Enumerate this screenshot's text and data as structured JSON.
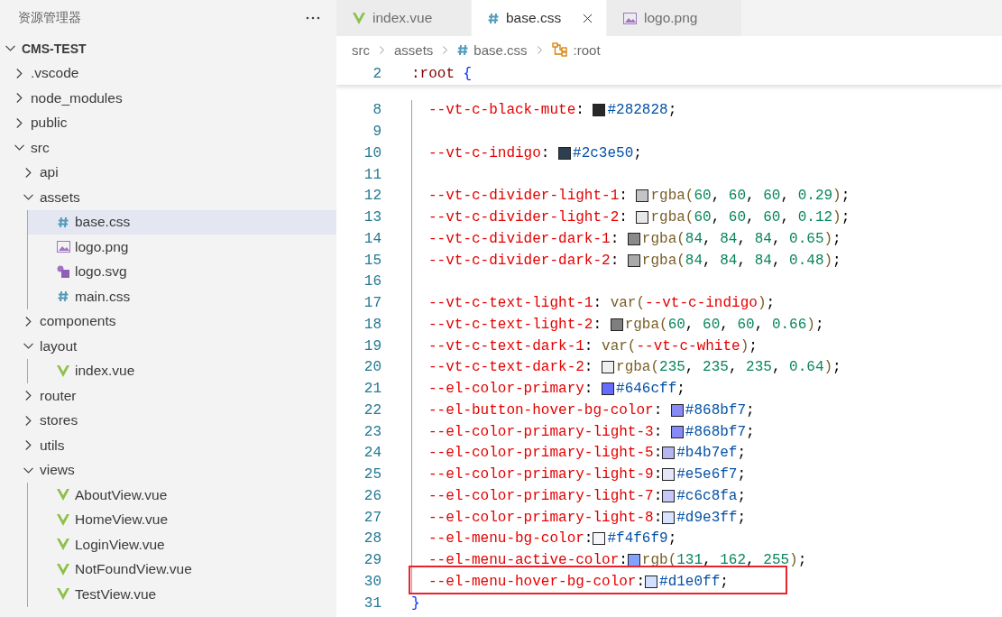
{
  "sidebar": {
    "title": "资源管理器",
    "root": {
      "label": "CMS-TEST",
      "kind": "folder",
      "expanded": true,
      "selected": false,
      "children": [
        {
          "label": ".vscode",
          "kind": "folder",
          "expanded": false,
          "selected": false
        },
        {
          "label": "node_modules",
          "kind": "folder",
          "expanded": false,
          "selected": false
        },
        {
          "label": "public",
          "kind": "folder",
          "expanded": false,
          "selected": false
        },
        {
          "label": "src",
          "kind": "folder",
          "expanded": true,
          "selected": false,
          "children": [
            {
              "label": "api",
              "kind": "folder",
              "expanded": false,
              "selected": false
            },
            {
              "label": "assets",
              "kind": "folder",
              "expanded": true,
              "selected": false,
              "children": [
                {
                  "label": "base.css",
                  "kind": "css",
                  "selected": true
                },
                {
                  "label": "logo.png",
                  "kind": "image",
                  "selected": false
                },
                {
                  "label": "logo.svg",
                  "kind": "svg",
                  "selected": false
                },
                {
                  "label": "main.css",
                  "kind": "css",
                  "selected": false
                }
              ]
            },
            {
              "label": "components",
              "kind": "folder",
              "expanded": false,
              "selected": false
            },
            {
              "label": "layout",
              "kind": "folder",
              "expanded": true,
              "selected": false,
              "children": [
                {
                  "label": "index.vue",
                  "kind": "vue",
                  "selected": false
                }
              ]
            },
            {
              "label": "router",
              "kind": "folder",
              "expanded": false,
              "selected": false
            },
            {
              "label": "stores",
              "kind": "folder",
              "expanded": false,
              "selected": false
            },
            {
              "label": "utils",
              "kind": "folder",
              "expanded": false,
              "selected": false
            },
            {
              "label": "views",
              "kind": "folder",
              "expanded": true,
              "selected": false,
              "children": [
                {
                  "label": "AboutView.vue",
                  "kind": "vue",
                  "selected": false
                },
                {
                  "label": "HomeView.vue",
                  "kind": "vue",
                  "selected": false
                },
                {
                  "label": "LoginView.vue",
                  "kind": "vue",
                  "selected": false
                },
                {
                  "label": "NotFoundView.vue",
                  "kind": "vue",
                  "selected": false
                },
                {
                  "label": "TestView.vue",
                  "kind": "vue",
                  "selected": false
                }
              ]
            }
          ]
        }
      ]
    }
  },
  "tabs": [
    {
      "label": "index.vue",
      "kind": "vue",
      "selected": false
    },
    {
      "label": "base.css",
      "kind": "css",
      "selected": true
    },
    {
      "label": "logo.png",
      "kind": "image",
      "selected": false
    }
  ],
  "breadcrumb": [
    {
      "label": "src",
      "kind": "folder"
    },
    {
      "label": "assets",
      "kind": "folder"
    },
    {
      "label": "base.css",
      "kind": "css"
    },
    {
      "label": ":root",
      "kind": "symbol"
    }
  ],
  "sticky_line": {
    "number": "2",
    "tokens": [
      {
        "kind": "selector",
        "text": ":root"
      },
      {
        "kind": "brace",
        "text": " {"
      }
    ]
  },
  "lines": [
    {
      "number": "8",
      "kind": "decl",
      "tokens": [
        {
          "kind": "prop",
          "text": "--vt-c-black-mute"
        },
        {
          "kind": "punct",
          "text": ": "
        },
        {
          "kind": "swatch",
          "color": "#282828"
        },
        {
          "kind": "hex",
          "text": "#282828"
        },
        {
          "kind": "punct",
          "text": ";"
        }
      ]
    },
    {
      "number": "9",
      "kind": "decl"
    },
    {
      "number": "10",
      "kind": "decl",
      "tokens": [
        {
          "kind": "prop",
          "text": "--vt-c-indigo"
        },
        {
          "kind": "punct",
          "text": ": "
        },
        {
          "kind": "swatch",
          "color": "#2c3e50"
        },
        {
          "kind": "hex",
          "text": "#2c3e50"
        },
        {
          "kind": "punct",
          "text": ";"
        }
      ]
    },
    {
      "number": "11",
      "kind": "decl"
    },
    {
      "number": "12",
      "kind": "decl",
      "tokens": [
        {
          "kind": "prop",
          "text": "--vt-c-divider-light-1"
        },
        {
          "kind": "punct",
          "text": ": "
        },
        {
          "kind": "swatch",
          "color": "#c4c4c4"
        },
        {
          "kind": "fn",
          "text": "rgba("
        },
        {
          "kind": "num",
          "text": "60"
        },
        {
          "kind": "punct",
          "text": ", "
        },
        {
          "kind": "num",
          "text": "60"
        },
        {
          "kind": "punct",
          "text": ", "
        },
        {
          "kind": "num",
          "text": "60"
        },
        {
          "kind": "punct",
          "text": ", "
        },
        {
          "kind": "num",
          "text": "0.29"
        },
        {
          "kind": "fn",
          "text": ")"
        },
        {
          "kind": "punct",
          "text": ";"
        }
      ]
    },
    {
      "number": "13",
      "kind": "decl",
      "tokens": [
        {
          "kind": "prop",
          "text": "--vt-c-divider-light-2"
        },
        {
          "kind": "punct",
          "text": ": "
        },
        {
          "kind": "swatch",
          "color": "#e7e7e7"
        },
        {
          "kind": "fn",
          "text": "rgba("
        },
        {
          "kind": "num",
          "text": "60"
        },
        {
          "kind": "punct",
          "text": ", "
        },
        {
          "kind": "num",
          "text": "60"
        },
        {
          "kind": "punct",
          "text": ", "
        },
        {
          "kind": "num",
          "text": "60"
        },
        {
          "kind": "punct",
          "text": ", "
        },
        {
          "kind": "num",
          "text": "0.12"
        },
        {
          "kind": "fn",
          "text": ")"
        },
        {
          "kind": "punct",
          "text": ";"
        }
      ]
    },
    {
      "number": "14",
      "kind": "decl",
      "tokens": [
        {
          "kind": "prop",
          "text": "--vt-c-divider-dark-1"
        },
        {
          "kind": "punct",
          "text": ": "
        },
        {
          "kind": "swatch",
          "color": "#8a8a8a"
        },
        {
          "kind": "fn",
          "text": "rgba("
        },
        {
          "kind": "num",
          "text": "84"
        },
        {
          "kind": "punct",
          "text": ", "
        },
        {
          "kind": "num",
          "text": "84"
        },
        {
          "kind": "punct",
          "text": ", "
        },
        {
          "kind": "num",
          "text": "84"
        },
        {
          "kind": "punct",
          "text": ", "
        },
        {
          "kind": "num",
          "text": "0.65"
        },
        {
          "kind": "fn",
          "text": ")"
        },
        {
          "kind": "punct",
          "text": ";"
        }
      ]
    },
    {
      "number": "15",
      "kind": "decl",
      "tokens": [
        {
          "kind": "prop",
          "text": "--vt-c-divider-dark-2"
        },
        {
          "kind": "punct",
          "text": ": "
        },
        {
          "kind": "swatch",
          "color": "#a9a9a9"
        },
        {
          "kind": "fn",
          "text": "rgba("
        },
        {
          "kind": "num",
          "text": "84"
        },
        {
          "kind": "punct",
          "text": ", "
        },
        {
          "kind": "num",
          "text": "84"
        },
        {
          "kind": "punct",
          "text": ", "
        },
        {
          "kind": "num",
          "text": "84"
        },
        {
          "kind": "punct",
          "text": ", "
        },
        {
          "kind": "num",
          "text": "0.48"
        },
        {
          "kind": "fn",
          "text": ")"
        },
        {
          "kind": "punct",
          "text": ";"
        }
      ]
    },
    {
      "number": "16",
      "kind": "decl"
    },
    {
      "number": "17",
      "kind": "decl",
      "tokens": [
        {
          "kind": "prop",
          "text": "--vt-c-text-light-1"
        },
        {
          "kind": "punct",
          "text": ": "
        },
        {
          "kind": "fn",
          "text": "var("
        },
        {
          "kind": "prop",
          "text": "--vt-c-indigo"
        },
        {
          "kind": "fn",
          "text": ")"
        },
        {
          "kind": "punct",
          "text": ";"
        }
      ]
    },
    {
      "number": "18",
      "kind": "decl",
      "tokens": [
        {
          "kind": "prop",
          "text": "--vt-c-text-light-2"
        },
        {
          "kind": "punct",
          "text": ": "
        },
        {
          "kind": "swatch",
          "color": "#7e7e7e"
        },
        {
          "kind": "fn",
          "text": "rgba("
        },
        {
          "kind": "num",
          "text": "60"
        },
        {
          "kind": "punct",
          "text": ", "
        },
        {
          "kind": "num",
          "text": "60"
        },
        {
          "kind": "punct",
          "text": ", "
        },
        {
          "kind": "num",
          "text": "60"
        },
        {
          "kind": "punct",
          "text": ", "
        },
        {
          "kind": "num",
          "text": "0.66"
        },
        {
          "kind": "fn",
          "text": ")"
        },
        {
          "kind": "punct",
          "text": ";"
        }
      ]
    },
    {
      "number": "19",
      "kind": "decl",
      "tokens": [
        {
          "kind": "prop",
          "text": "--vt-c-text-dark-1"
        },
        {
          "kind": "punct",
          "text": ": "
        },
        {
          "kind": "fn",
          "text": "var("
        },
        {
          "kind": "prop",
          "text": "--vt-c-white"
        },
        {
          "kind": "fn",
          "text": ")"
        },
        {
          "kind": "punct",
          "text": ";"
        }
      ]
    },
    {
      "number": "20",
      "kind": "decl",
      "tokens": [
        {
          "kind": "prop",
          "text": "--vt-c-text-dark-2"
        },
        {
          "kind": "punct",
          "text": ": "
        },
        {
          "kind": "swatch",
          "color": "#efefef"
        },
        {
          "kind": "fn",
          "text": "rgba("
        },
        {
          "kind": "num",
          "text": "235"
        },
        {
          "kind": "punct",
          "text": ", "
        },
        {
          "kind": "num",
          "text": "235"
        },
        {
          "kind": "punct",
          "text": ", "
        },
        {
          "kind": "num",
          "text": "235"
        },
        {
          "kind": "punct",
          "text": ", "
        },
        {
          "kind": "num",
          "text": "0.64"
        },
        {
          "kind": "fn",
          "text": ")"
        },
        {
          "kind": "punct",
          "text": ";"
        }
      ]
    },
    {
      "number": "21",
      "kind": "decl",
      "tokens": [
        {
          "kind": "prop",
          "text": "--el-color-primary"
        },
        {
          "kind": "punct",
          "text": ": "
        },
        {
          "kind": "swatch",
          "color": "#646cff"
        },
        {
          "kind": "hex",
          "text": "#646cff"
        },
        {
          "kind": "punct",
          "text": ";"
        }
      ]
    },
    {
      "number": "22",
      "kind": "decl",
      "tokens": [
        {
          "kind": "prop",
          "text": "--el-button-hover-bg-color"
        },
        {
          "kind": "punct",
          "text": ": "
        },
        {
          "kind": "swatch",
          "color": "#868bf7"
        },
        {
          "kind": "hex",
          "text": "#868bf7"
        },
        {
          "kind": "punct",
          "text": ";"
        }
      ]
    },
    {
      "number": "23",
      "kind": "decl",
      "tokens": [
        {
          "kind": "prop",
          "text": "--el-color-primary-light-3"
        },
        {
          "kind": "punct",
          "text": ": "
        },
        {
          "kind": "swatch",
          "color": "#868bf7"
        },
        {
          "kind": "hex",
          "text": "#868bf7"
        },
        {
          "kind": "punct",
          "text": ";"
        }
      ]
    },
    {
      "number": "24",
      "kind": "decl",
      "tokens": [
        {
          "kind": "prop",
          "text": "--el-color-primary-light-5"
        },
        {
          "kind": "punct",
          "text": ":"
        },
        {
          "kind": "swatch",
          "color": "#b4b7ef"
        },
        {
          "kind": "hex",
          "text": "#b4b7ef"
        },
        {
          "kind": "punct",
          "text": ";"
        }
      ]
    },
    {
      "number": "25",
      "kind": "decl",
      "tokens": [
        {
          "kind": "prop",
          "text": "--el-color-primary-light-9"
        },
        {
          "kind": "punct",
          "text": ":"
        },
        {
          "kind": "swatch",
          "color": "#e5e6f7"
        },
        {
          "kind": "hex",
          "text": "#e5e6f7"
        },
        {
          "kind": "punct",
          "text": ";"
        }
      ]
    },
    {
      "number": "26",
      "kind": "decl",
      "tokens": [
        {
          "kind": "prop",
          "text": "--el-color-primary-light-7"
        },
        {
          "kind": "punct",
          "text": ":"
        },
        {
          "kind": "swatch",
          "color": "#c6c8fa"
        },
        {
          "kind": "hex",
          "text": "#c6c8fa"
        },
        {
          "kind": "punct",
          "text": ";"
        }
      ]
    },
    {
      "number": "27",
      "kind": "decl",
      "tokens": [
        {
          "kind": "prop",
          "text": "--el-color-primary-light-8"
        },
        {
          "kind": "punct",
          "text": ":"
        },
        {
          "kind": "swatch",
          "color": "#d9e3ff"
        },
        {
          "kind": "hex",
          "text": "#d9e3ff"
        },
        {
          "kind": "punct",
          "text": ";"
        }
      ]
    },
    {
      "number": "28",
      "kind": "decl",
      "tokens": [
        {
          "kind": "prop",
          "text": "--el-menu-bg-color"
        },
        {
          "kind": "punct",
          "text": ":"
        },
        {
          "kind": "swatch",
          "color": "#f4f6f9"
        },
        {
          "kind": "hex",
          "text": "#f4f6f9"
        },
        {
          "kind": "punct",
          "text": ";"
        }
      ]
    },
    {
      "number": "29",
      "kind": "decl",
      "tokens": [
        {
          "kind": "prop",
          "text": "--el-menu-active-color"
        },
        {
          "kind": "punct",
          "text": ":"
        },
        {
          "kind": "swatch",
          "color": "#83a2ff"
        },
        {
          "kind": "fn",
          "text": "rgb("
        },
        {
          "kind": "num",
          "text": "131"
        },
        {
          "kind": "punct",
          "text": ", "
        },
        {
          "kind": "num",
          "text": "162"
        },
        {
          "kind": "punct",
          "text": ", "
        },
        {
          "kind": "num",
          "text": "255"
        },
        {
          "kind": "fn",
          "text": ")"
        },
        {
          "kind": "punct",
          "text": ";"
        }
      ]
    },
    {
      "number": "30",
      "kind": "decl",
      "highlighted": true,
      "tokens": [
        {
          "kind": "prop",
          "text": "--el-menu-hover-bg-color"
        },
        {
          "kind": "punct",
          "text": ":"
        },
        {
          "kind": "swatch",
          "color": "#d1e0ff"
        },
        {
          "kind": "hex",
          "text": "#d1e0ff"
        },
        {
          "kind": "punct",
          "text": ";"
        }
      ]
    },
    {
      "number": "31",
      "kind": "rule",
      "tokens": [
        {
          "kind": "brace",
          "text": "}"
        }
      ]
    }
  ]
}
